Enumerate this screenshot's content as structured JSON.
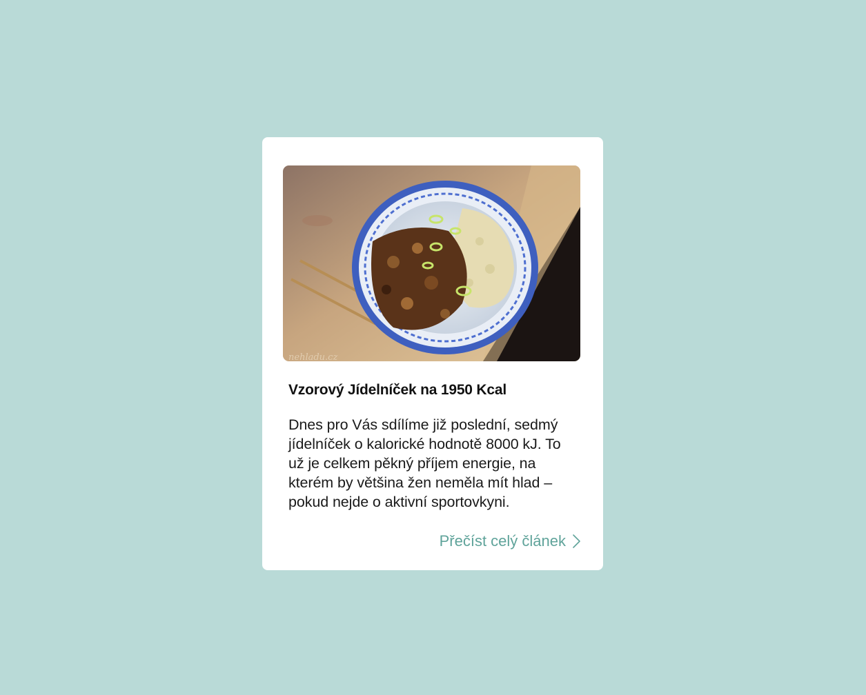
{
  "card": {
    "image_alt": "Miska s kořeněnými hříbky, rýží a jarní cibulkou",
    "watermark": "nehladu.cz",
    "title": "Vzorový Jídelníček na 1950 Kcal",
    "excerpt": "Dnes pro Vás sdílíme již poslední, sedmý jídelníček o kalorické hodnotě 8000 kJ. To už je celkem pěkný příjem energie, na kterém by většina žen neměla mít hlad – pokud nejde o aktivní sportovkyni.",
    "read_more_label": "Přečíst celý článek",
    "read_more_icon": "chevron-right-icon"
  },
  "colors": {
    "background": "#b9dad7",
    "card": "#ffffff",
    "link": "#5fa39a",
    "title": "#111111"
  }
}
